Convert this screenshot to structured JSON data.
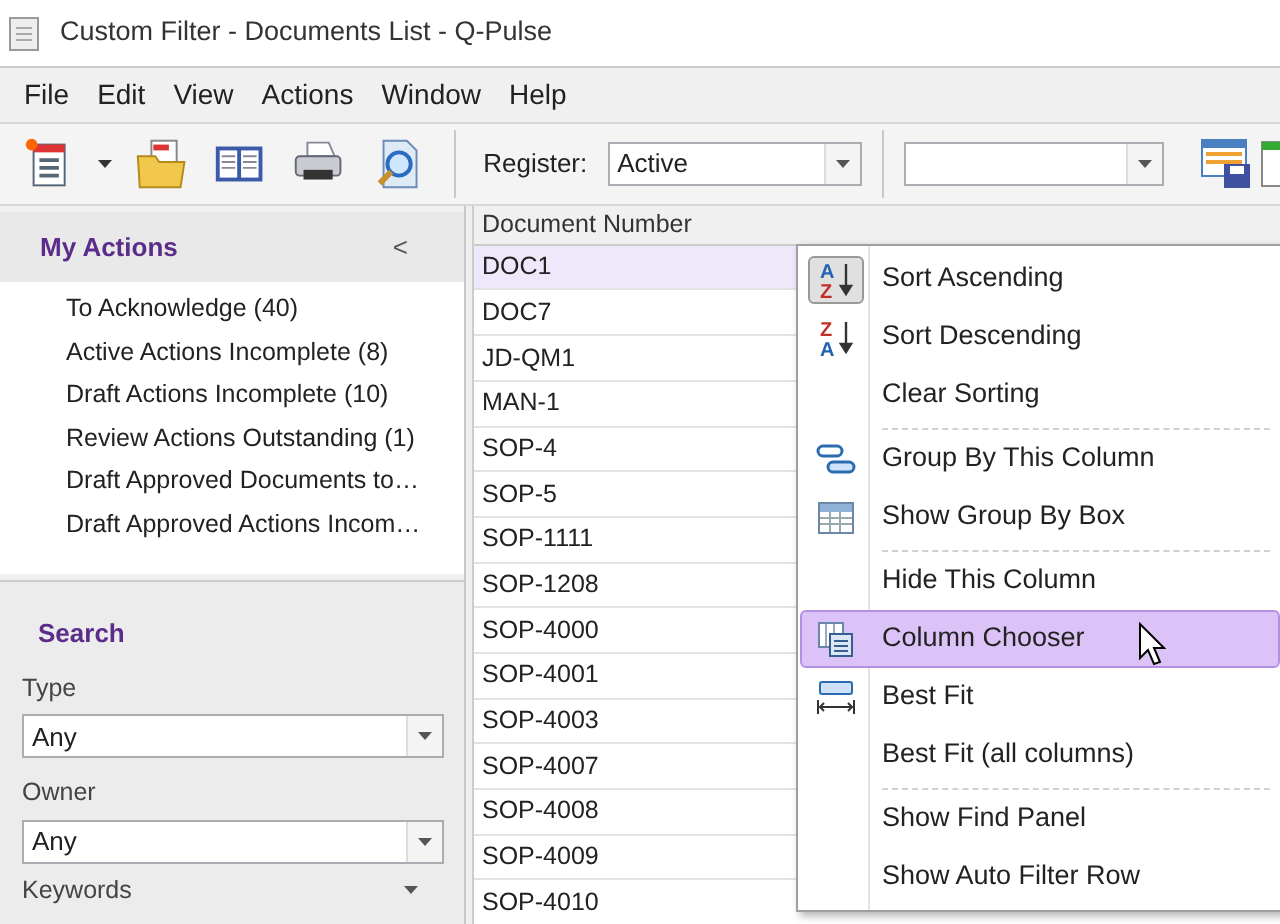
{
  "window": {
    "title": "Custom Filter - Documents List - Q-Pulse"
  },
  "menu_bar": [
    "File",
    "Edit",
    "View",
    "Actions",
    "Window",
    "Help"
  ],
  "toolbar": {
    "register_label": "Register:",
    "register_value": "Active"
  },
  "my_actions": {
    "title": "My Actions",
    "collapse_glyph": "<",
    "items": [
      "To Acknowledge (40)",
      "Active Actions Incomplete (8)",
      "Draft Actions Incomplete (10)",
      "Review Actions Outstanding (1)",
      "Draft Approved Documents to…",
      "Draft Approved Actions Incom…"
    ]
  },
  "search": {
    "title": "Search",
    "fields": [
      {
        "label": "Type",
        "value": "Any"
      },
      {
        "label": "Owner",
        "value": "Any"
      }
    ],
    "keywords_label": "Keywords"
  },
  "table": {
    "columns": [
      "Document Number"
    ],
    "rows": [
      {
        "cell": "DOC1",
        "selected": true
      },
      {
        "cell": "DOC7",
        "selected": false
      },
      {
        "cell": "JD-QM1",
        "selected": false
      },
      {
        "cell": "MAN-1",
        "selected": false
      },
      {
        "cell": "SOP-4",
        "selected": false
      },
      {
        "cell": "SOP-5",
        "selected": false
      },
      {
        "cell": "SOP-1111",
        "selected": false
      },
      {
        "cell": "SOP-1208",
        "selected": false
      },
      {
        "cell": "SOP-4000",
        "selected": false
      },
      {
        "cell": "SOP-4001",
        "selected": false
      },
      {
        "cell": "SOP-4003",
        "selected": false
      },
      {
        "cell": "SOP-4007",
        "selected": false
      },
      {
        "cell": "SOP-4008",
        "selected": false
      },
      {
        "cell": "SOP-4009",
        "selected": false
      },
      {
        "cell": "SOP-4010",
        "selected": false
      }
    ]
  },
  "context_menu": [
    {
      "label": "Sort Ascending",
      "icon_letters": [
        "A",
        "Z"
      ],
      "checked": true,
      "selected": false,
      "separator_before": false
    },
    {
      "label": "Sort Descending",
      "icon_letters": [
        "Z",
        "A"
      ],
      "checked": false,
      "selected": false,
      "separator_before": false
    },
    {
      "label": "Clear Sorting",
      "checked": false,
      "selected": false,
      "separator_before": false
    },
    {
      "label": "Group By This Column",
      "checked": false,
      "selected": false,
      "separator_before": true
    },
    {
      "label": "Show Group By Box",
      "checked": false,
      "selected": false,
      "separator_before": false
    },
    {
      "label": "Hide This Column",
      "checked": false,
      "selected": false,
      "separator_before": true
    },
    {
      "label": "Column Chooser",
      "checked": false,
      "selected": true,
      "separator_before": false
    },
    {
      "label": "Best Fit",
      "checked": false,
      "selected": false,
      "separator_before": false
    },
    {
      "label": "Best Fit (all columns)",
      "checked": false,
      "selected": false,
      "separator_before": false
    },
    {
      "label": "Show Find Panel",
      "checked": false,
      "selected": false,
      "separator_before": true
    },
    {
      "label": "Show Auto Filter Row",
      "checked": false,
      "selected": false,
      "separator_before": false
    }
  ]
}
